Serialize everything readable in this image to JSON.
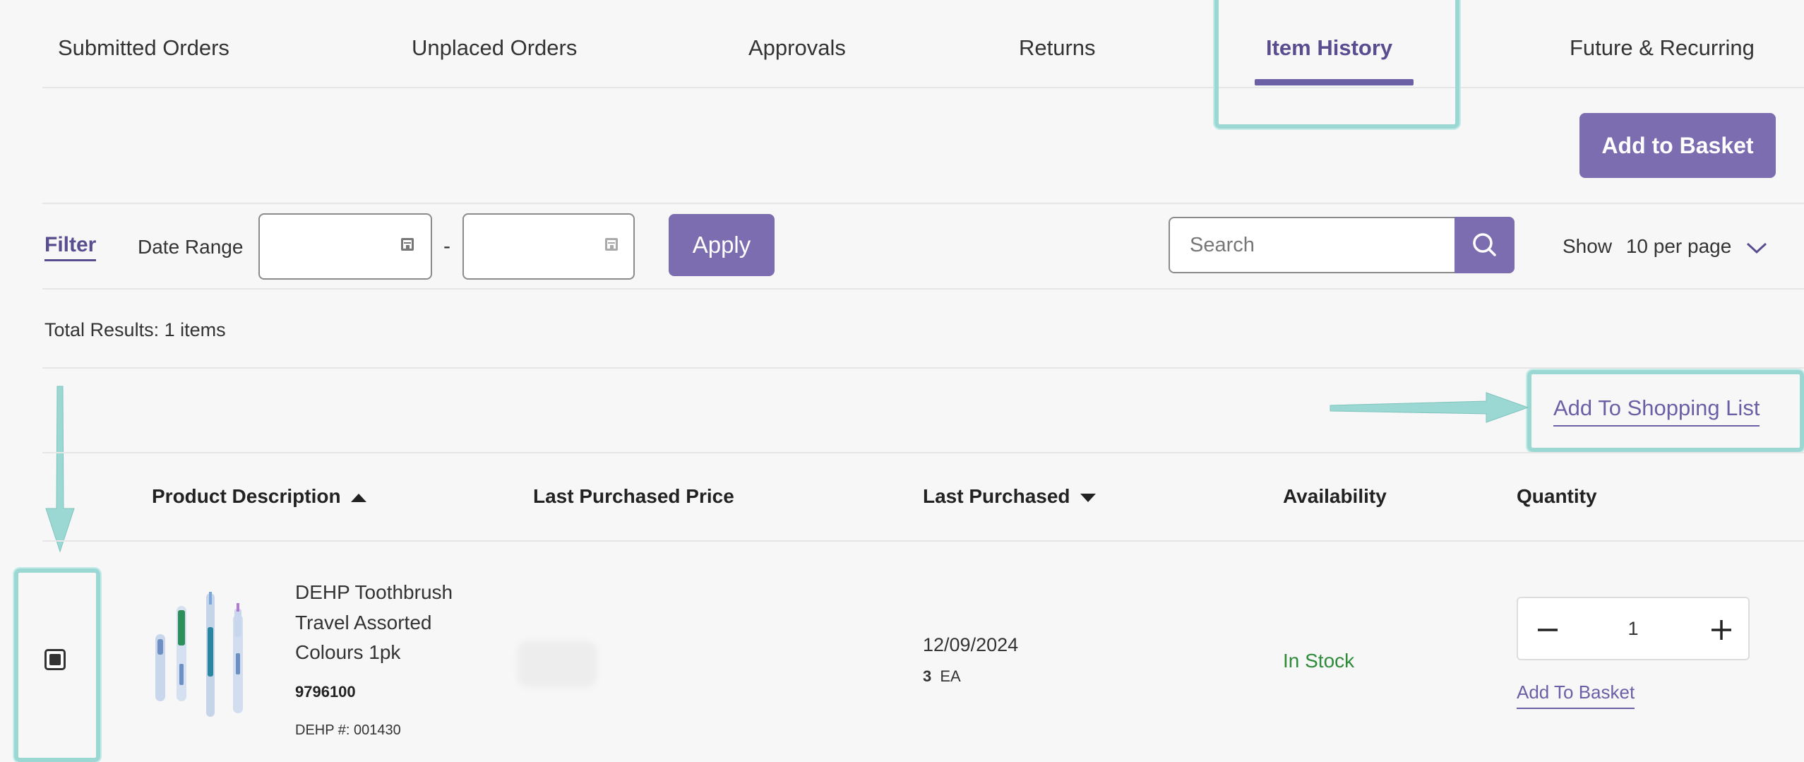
{
  "tabs": [
    {
      "label": "Submitted Orders",
      "active": false
    },
    {
      "label": "Unplaced Orders",
      "active": false
    },
    {
      "label": "Approvals",
      "active": false
    },
    {
      "label": "Returns",
      "active": false
    },
    {
      "label": "Item History",
      "active": true
    },
    {
      "label": "Future & Recurring",
      "active": false
    }
  ],
  "toolbar": {
    "add_to_basket_label": "Add to Basket"
  },
  "filter": {
    "filter_label": "Filter",
    "date_range_label": "Date Range",
    "date_separator": "-",
    "date_from_value": "",
    "date_to_value": "",
    "apply_label": "Apply",
    "search_placeholder": "Search",
    "show_label": "Show",
    "per_page_value": "10 per page"
  },
  "results": {
    "total_text": "Total Results: 1 items",
    "add_to_shopping_list_label": "Add To Shopping List"
  },
  "table": {
    "headers": {
      "product_description": "Product Description",
      "last_purchased_price": "Last Purchased Price",
      "last_purchased": "Last Purchased",
      "availability": "Availability",
      "quantity": "Quantity"
    },
    "rows": [
      {
        "checked": true,
        "name_line1": "DEHP Toothbrush",
        "name_line2": "Travel Assorted",
        "name_line3": "Colours 1pk",
        "sku": "9796100",
        "dehp_number": "DEHP #: 001430",
        "last_purchased_date": "12/09/2024",
        "purchased_qty": "3",
        "purchased_unit": "EA",
        "availability": "In Stock",
        "quantity": "1",
        "add_to_basket_label": "Add To Basket"
      }
    ]
  },
  "colors": {
    "accent": "#7b6db0",
    "highlight": "#9cd8d3",
    "in_stock": "#2e8b3a"
  }
}
